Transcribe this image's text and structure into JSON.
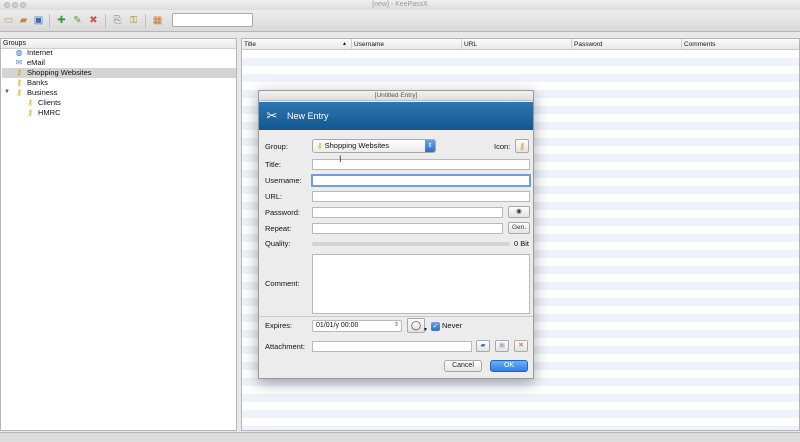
{
  "window": {
    "title": "[new] - KeePassX"
  },
  "toolbar": {
    "icons": [
      "new-database-icon",
      "open-database-icon",
      "save-database-icon",
      "add-entry-icon",
      "edit-entry-icon",
      "delete-entry-icon",
      "copy-username-icon",
      "copy-password-icon",
      "lock-icon"
    ],
    "search_value": ""
  },
  "groups": {
    "header": "Groups",
    "items": [
      {
        "label": "Internet",
        "icon": "globe-icon"
      },
      {
        "label": "eMail",
        "icon": "envelope-icon"
      },
      {
        "label": "Shopping Websites",
        "icon": "key-icon",
        "selected": true
      },
      {
        "label": "Banks",
        "icon": "key-icon"
      },
      {
        "label": "Business",
        "icon": "key-icon",
        "expanded": true
      },
      {
        "label": "Clients",
        "icon": "key-icon"
      },
      {
        "label": "HMRC",
        "icon": "key-icon"
      }
    ]
  },
  "entries": {
    "columns": [
      "Title",
      "Username",
      "URL",
      "Password",
      "Comments"
    ],
    "sort_column": "Title"
  },
  "dialog": {
    "window_title": "[Untitled Entry]",
    "banner_title": "New Entry",
    "group_label": "Group:",
    "group_value": "Shopping Websites",
    "icon_label": "Icon:",
    "title_label": "Title:",
    "title_value": "",
    "username_label": "Username:",
    "username_value": "",
    "url_label": "URL:",
    "url_value": "",
    "password_label": "Password:",
    "password_value": "",
    "repeat_label": "Repeat:",
    "repeat_value": "",
    "gen_label": "Gen.",
    "quality_label": "Quality:",
    "quality_value": "0 Bit",
    "comment_label": "Comment:",
    "expires_label": "Expires:",
    "expires_value": "01/01/y 00:00",
    "never_label": "Never",
    "never_checked": true,
    "attachment_label": "Attachment:",
    "attachment_value": "",
    "cancel_label": "Cancel",
    "ok_label": "OK"
  },
  "colors": {
    "accent": "#2b7fe3",
    "banner": "#1a63a0",
    "stripe": "#edf2fb"
  }
}
